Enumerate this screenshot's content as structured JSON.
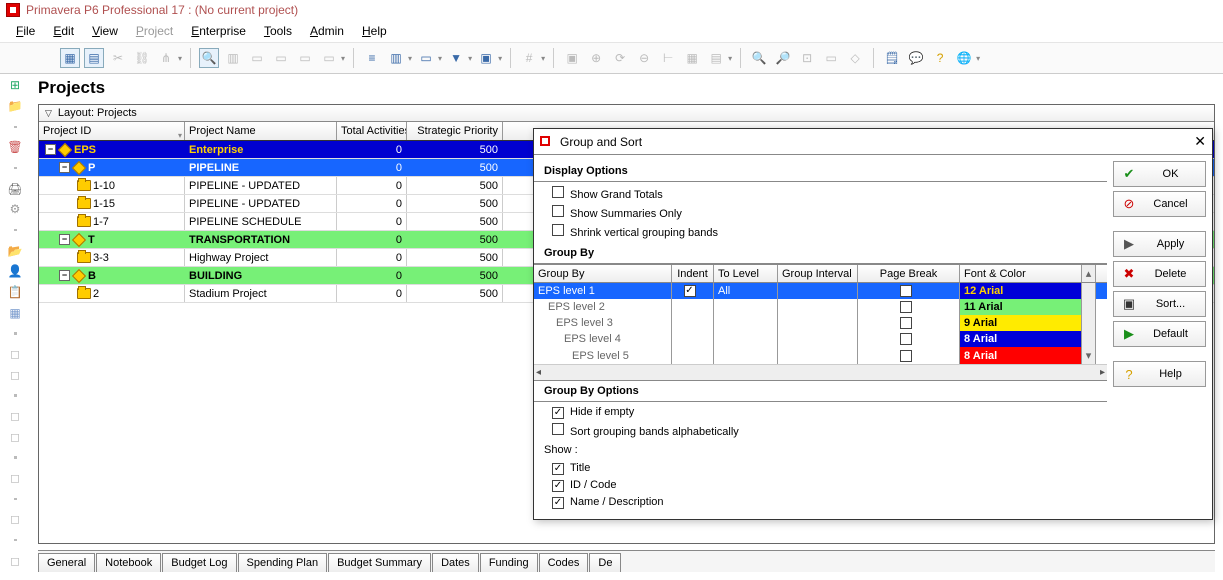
{
  "title": "Primavera P6 Professional 17 : (No current project)",
  "menubar": [
    "File",
    "Edit",
    "View",
    "Project",
    "Enterprise",
    "Tools",
    "Admin",
    "Help"
  ],
  "menubar_disabled_index": 3,
  "heading": "Projects",
  "layout_label": "Layout: Projects",
  "columns": {
    "id": "Project ID",
    "name": "Project Name",
    "act": "Total Activities",
    "sp": "Strategic Priority"
  },
  "rows": [
    {
      "level": 0,
      "style": "lvl0",
      "expand": "-",
      "id": "EPS",
      "name": "Enterprise",
      "act": "0",
      "sp": "500",
      "indent": 0,
      "icon": "diamond"
    },
    {
      "level": 1,
      "style": "lvl1a",
      "expand": "-",
      "id": "P",
      "name": "PIPELINE",
      "act": "0",
      "sp": "500",
      "indent": 14,
      "icon": "diamond"
    },
    {
      "level": 2,
      "style": "leaf",
      "expand": "",
      "id": "1-10",
      "name": "PIPELINE - UPDATED",
      "act": "0",
      "sp": "500",
      "indent": 32,
      "icon": "folder"
    },
    {
      "level": 2,
      "style": "leaf",
      "expand": "",
      "id": "1-15",
      "name": "PIPELINE - UPDATED",
      "act": "0",
      "sp": "500",
      "indent": 32,
      "icon": "folder"
    },
    {
      "level": 2,
      "style": "leaf",
      "expand": "",
      "id": "1-7",
      "name": "PIPELINE SCHEDULE",
      "act": "0",
      "sp": "500",
      "indent": 32,
      "icon": "folder"
    },
    {
      "level": 1,
      "style": "lvl1b",
      "expand": "-",
      "id": "T",
      "name": "TRANSPORTATION",
      "act": "0",
      "sp": "500",
      "indent": 14,
      "icon": "diamond"
    },
    {
      "level": 2,
      "style": "leaf",
      "expand": "",
      "id": "3-3",
      "name": "Highway Project",
      "act": "0",
      "sp": "500",
      "indent": 32,
      "icon": "folder"
    },
    {
      "level": 1,
      "style": "lvl1b",
      "expand": "-",
      "id": "B",
      "name": "BUILDING",
      "act": "0",
      "sp": "500",
      "indent": 14,
      "icon": "diamond"
    },
    {
      "level": 2,
      "style": "leaf",
      "expand": "",
      "id": "2",
      "name": "Stadium Project",
      "act": "0",
      "sp": "500",
      "indent": 32,
      "icon": "folder"
    }
  ],
  "bottom_tabs": [
    "General",
    "Notebook",
    "Budget Log",
    "Spending Plan",
    "Budget Summary",
    "Dates",
    "Funding",
    "Codes",
    "De"
  ],
  "dialog": {
    "title": "Group and Sort",
    "buttons": {
      "ok": "OK",
      "cancel": "Cancel",
      "apply": "Apply",
      "delete": "Delete",
      "sort": "Sort...",
      "default": "Default",
      "help": "Help"
    },
    "display_options_head": "Display Options",
    "display_options": [
      {
        "label": "Show Grand Totals",
        "checked": false
      },
      {
        "label": "Show Summaries Only",
        "checked": false
      },
      {
        "label": "Shrink vertical grouping bands",
        "checked": false
      }
    ],
    "group_by_head": "Group By",
    "gb_columns": {
      "gb": "Group By",
      "ind": "Indent",
      "tl": "To Level",
      "gi": "Group Interval",
      "pb": "Page Break",
      "fc": "Font & Color"
    },
    "gb_rows": [
      {
        "label": "EPS level 1",
        "sub": 0,
        "selected": true,
        "indent": true,
        "to_level": "All",
        "pb": false,
        "fc": "12 Arial",
        "fc_style": "fc1"
      },
      {
        "label": "EPS level 2",
        "sub": 1,
        "selected": false,
        "indent": null,
        "to_level": "",
        "pb": false,
        "fc": "11 Arial",
        "fc_style": "fc2"
      },
      {
        "label": "EPS level 3",
        "sub": 2,
        "selected": false,
        "indent": null,
        "to_level": "",
        "pb": false,
        "fc": "9 Arial",
        "fc_style": "fc3"
      },
      {
        "label": "EPS level 4",
        "sub": 3,
        "selected": false,
        "indent": null,
        "to_level": "",
        "pb": false,
        "fc": "8 Arial",
        "fc_style": "fc4"
      },
      {
        "label": "EPS level 5",
        "sub": 4,
        "selected": false,
        "indent": null,
        "to_level": "",
        "pb": false,
        "fc": "8 Arial",
        "fc_style": "fc5"
      }
    ],
    "gb_options_head": "Group By Options",
    "gb_options": [
      {
        "label": "Hide if empty",
        "checked": true
      },
      {
        "label": "Sort grouping bands alphabetically",
        "checked": false
      }
    ],
    "show_label": "Show :",
    "show_opts": [
      {
        "label": "Title",
        "checked": true
      },
      {
        "label": "ID / Code",
        "checked": true
      },
      {
        "label": "Name / Description",
        "checked": true
      }
    ]
  }
}
